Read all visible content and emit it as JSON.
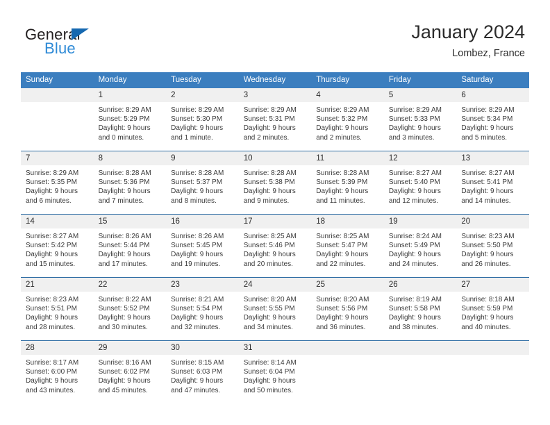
{
  "brand": {
    "name_top": "General",
    "name_bottom": "Blue",
    "accent_color": "#2e8ad6",
    "triangle_color": "#1568b0"
  },
  "header": {
    "title": "January 2024",
    "subtitle": "Lombez, France"
  },
  "theme": {
    "header_bg": "#3b7ebf",
    "daynum_bg": "#f0f0f0",
    "row_rule": "#2e6da4"
  },
  "weekdays": [
    "Sunday",
    "Monday",
    "Tuesday",
    "Wednesday",
    "Thursday",
    "Friday",
    "Saturday"
  ],
  "weeks": [
    [
      {
        "day": "",
        "sunrise": "",
        "sunset": "",
        "daylight_1": "",
        "daylight_2": ""
      },
      {
        "day": "1",
        "sunrise": "Sunrise: 8:29 AM",
        "sunset": "Sunset: 5:29 PM",
        "daylight_1": "Daylight: 9 hours",
        "daylight_2": "and 0 minutes."
      },
      {
        "day": "2",
        "sunrise": "Sunrise: 8:29 AM",
        "sunset": "Sunset: 5:30 PM",
        "daylight_1": "Daylight: 9 hours",
        "daylight_2": "and 1 minute."
      },
      {
        "day": "3",
        "sunrise": "Sunrise: 8:29 AM",
        "sunset": "Sunset: 5:31 PM",
        "daylight_1": "Daylight: 9 hours",
        "daylight_2": "and 2 minutes."
      },
      {
        "day": "4",
        "sunrise": "Sunrise: 8:29 AM",
        "sunset": "Sunset: 5:32 PM",
        "daylight_1": "Daylight: 9 hours",
        "daylight_2": "and 2 minutes."
      },
      {
        "day": "5",
        "sunrise": "Sunrise: 8:29 AM",
        "sunset": "Sunset: 5:33 PM",
        "daylight_1": "Daylight: 9 hours",
        "daylight_2": "and 3 minutes."
      },
      {
        "day": "6",
        "sunrise": "Sunrise: 8:29 AM",
        "sunset": "Sunset: 5:34 PM",
        "daylight_1": "Daylight: 9 hours",
        "daylight_2": "and 5 minutes."
      }
    ],
    [
      {
        "day": "7",
        "sunrise": "Sunrise: 8:29 AM",
        "sunset": "Sunset: 5:35 PM",
        "daylight_1": "Daylight: 9 hours",
        "daylight_2": "and 6 minutes."
      },
      {
        "day": "8",
        "sunrise": "Sunrise: 8:28 AM",
        "sunset": "Sunset: 5:36 PM",
        "daylight_1": "Daylight: 9 hours",
        "daylight_2": "and 7 minutes."
      },
      {
        "day": "9",
        "sunrise": "Sunrise: 8:28 AM",
        "sunset": "Sunset: 5:37 PM",
        "daylight_1": "Daylight: 9 hours",
        "daylight_2": "and 8 minutes."
      },
      {
        "day": "10",
        "sunrise": "Sunrise: 8:28 AM",
        "sunset": "Sunset: 5:38 PM",
        "daylight_1": "Daylight: 9 hours",
        "daylight_2": "and 9 minutes."
      },
      {
        "day": "11",
        "sunrise": "Sunrise: 8:28 AM",
        "sunset": "Sunset: 5:39 PM",
        "daylight_1": "Daylight: 9 hours",
        "daylight_2": "and 11 minutes."
      },
      {
        "day": "12",
        "sunrise": "Sunrise: 8:27 AM",
        "sunset": "Sunset: 5:40 PM",
        "daylight_1": "Daylight: 9 hours",
        "daylight_2": "and 12 minutes."
      },
      {
        "day": "13",
        "sunrise": "Sunrise: 8:27 AM",
        "sunset": "Sunset: 5:41 PM",
        "daylight_1": "Daylight: 9 hours",
        "daylight_2": "and 14 minutes."
      }
    ],
    [
      {
        "day": "14",
        "sunrise": "Sunrise: 8:27 AM",
        "sunset": "Sunset: 5:42 PM",
        "daylight_1": "Daylight: 9 hours",
        "daylight_2": "and 15 minutes."
      },
      {
        "day": "15",
        "sunrise": "Sunrise: 8:26 AM",
        "sunset": "Sunset: 5:44 PM",
        "daylight_1": "Daylight: 9 hours",
        "daylight_2": "and 17 minutes."
      },
      {
        "day": "16",
        "sunrise": "Sunrise: 8:26 AM",
        "sunset": "Sunset: 5:45 PM",
        "daylight_1": "Daylight: 9 hours",
        "daylight_2": "and 19 minutes."
      },
      {
        "day": "17",
        "sunrise": "Sunrise: 8:25 AM",
        "sunset": "Sunset: 5:46 PM",
        "daylight_1": "Daylight: 9 hours",
        "daylight_2": "and 20 minutes."
      },
      {
        "day": "18",
        "sunrise": "Sunrise: 8:25 AM",
        "sunset": "Sunset: 5:47 PM",
        "daylight_1": "Daylight: 9 hours",
        "daylight_2": "and 22 minutes."
      },
      {
        "day": "19",
        "sunrise": "Sunrise: 8:24 AM",
        "sunset": "Sunset: 5:49 PM",
        "daylight_1": "Daylight: 9 hours",
        "daylight_2": "and 24 minutes."
      },
      {
        "day": "20",
        "sunrise": "Sunrise: 8:23 AM",
        "sunset": "Sunset: 5:50 PM",
        "daylight_1": "Daylight: 9 hours",
        "daylight_2": "and 26 minutes."
      }
    ],
    [
      {
        "day": "21",
        "sunrise": "Sunrise: 8:23 AM",
        "sunset": "Sunset: 5:51 PM",
        "daylight_1": "Daylight: 9 hours",
        "daylight_2": "and 28 minutes."
      },
      {
        "day": "22",
        "sunrise": "Sunrise: 8:22 AM",
        "sunset": "Sunset: 5:52 PM",
        "daylight_1": "Daylight: 9 hours",
        "daylight_2": "and 30 minutes."
      },
      {
        "day": "23",
        "sunrise": "Sunrise: 8:21 AM",
        "sunset": "Sunset: 5:54 PM",
        "daylight_1": "Daylight: 9 hours",
        "daylight_2": "and 32 minutes."
      },
      {
        "day": "24",
        "sunrise": "Sunrise: 8:20 AM",
        "sunset": "Sunset: 5:55 PM",
        "daylight_1": "Daylight: 9 hours",
        "daylight_2": "and 34 minutes."
      },
      {
        "day": "25",
        "sunrise": "Sunrise: 8:20 AM",
        "sunset": "Sunset: 5:56 PM",
        "daylight_1": "Daylight: 9 hours",
        "daylight_2": "and 36 minutes."
      },
      {
        "day": "26",
        "sunrise": "Sunrise: 8:19 AM",
        "sunset": "Sunset: 5:58 PM",
        "daylight_1": "Daylight: 9 hours",
        "daylight_2": "and 38 minutes."
      },
      {
        "day": "27",
        "sunrise": "Sunrise: 8:18 AM",
        "sunset": "Sunset: 5:59 PM",
        "daylight_1": "Daylight: 9 hours",
        "daylight_2": "and 40 minutes."
      }
    ],
    [
      {
        "day": "28",
        "sunrise": "Sunrise: 8:17 AM",
        "sunset": "Sunset: 6:00 PM",
        "daylight_1": "Daylight: 9 hours",
        "daylight_2": "and 43 minutes."
      },
      {
        "day": "29",
        "sunrise": "Sunrise: 8:16 AM",
        "sunset": "Sunset: 6:02 PM",
        "daylight_1": "Daylight: 9 hours",
        "daylight_2": "and 45 minutes."
      },
      {
        "day": "30",
        "sunrise": "Sunrise: 8:15 AM",
        "sunset": "Sunset: 6:03 PM",
        "daylight_1": "Daylight: 9 hours",
        "daylight_2": "and 47 minutes."
      },
      {
        "day": "31",
        "sunrise": "Sunrise: 8:14 AM",
        "sunset": "Sunset: 6:04 PM",
        "daylight_1": "Daylight: 9 hours",
        "daylight_2": "and 50 minutes."
      },
      {
        "day": "",
        "sunrise": "",
        "sunset": "",
        "daylight_1": "",
        "daylight_2": ""
      },
      {
        "day": "",
        "sunrise": "",
        "sunset": "",
        "daylight_1": "",
        "daylight_2": ""
      },
      {
        "day": "",
        "sunrise": "",
        "sunset": "",
        "daylight_1": "",
        "daylight_2": ""
      }
    ]
  ]
}
